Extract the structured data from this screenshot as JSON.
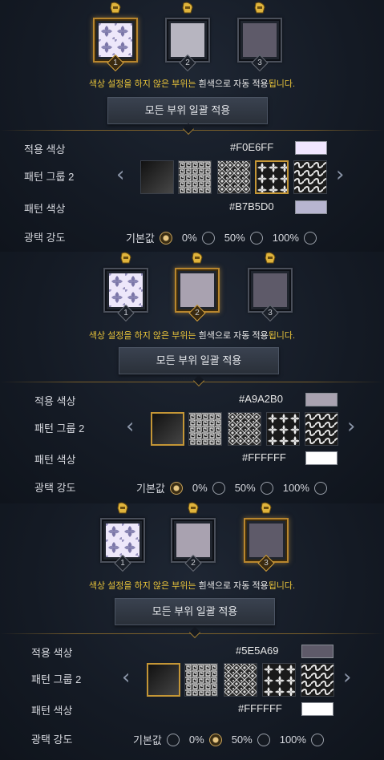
{
  "sections": [
    {
      "slots": [
        {
          "num": "1",
          "selected": true,
          "fill": "floral"
        },
        {
          "num": "2",
          "selected": false,
          "fill": "#B7B5C0"
        },
        {
          "num": "3",
          "selected": false,
          "fill": "#5E5A69"
        }
      ],
      "notice": {
        "yellow_a": "색상 설정을 하지 않은 부위는 ",
        "white": "흰색으로 자동 적용",
        "yellow_b": "됩니다."
      },
      "apply_label": "모든 부위 일괄 적용",
      "applied_color_label": "적용 색상",
      "applied_color_hex": "#F0E6FF",
      "applied_color": "#F0E6FF",
      "pattern_group_label": "패턴 그룹 2",
      "pattern_color_label": "패턴 색상",
      "pattern_color_hex": "#B7B5D0",
      "pattern_color": "#B7B5D0",
      "gloss_label": "광택 강도",
      "gloss_options": [
        "기본값",
        "0%",
        "50%",
        "100%"
      ],
      "gloss_selected": 0,
      "selected_pattern": 3
    },
    {
      "slots": [
        {
          "num": "1",
          "selected": false,
          "fill": "floral"
        },
        {
          "num": "2",
          "selected": true,
          "fill": "#A9A2B0"
        },
        {
          "num": "3",
          "selected": false,
          "fill": "#5E5A69"
        }
      ],
      "notice": {
        "yellow_a": "색상 설정을 하지 않은 부위는 ",
        "white": "흰색으로 자동 적용",
        "yellow_b": "됩니다."
      },
      "apply_label": "모든 부위 일괄 적용",
      "applied_color_label": "적용 색상",
      "applied_color_hex": "#A9A2B0",
      "applied_color": "#A9A2B0",
      "pattern_group_label": "패턴 그룹 2",
      "pattern_color_label": "패턴 색상",
      "pattern_color_hex": "#FFFFFF",
      "pattern_color": "#FFFFFF",
      "gloss_label": "광택 강도",
      "gloss_options": [
        "기본값",
        "0%",
        "50%",
        "100%"
      ],
      "gloss_selected": 0,
      "selected_pattern": 0
    },
    {
      "slots": [
        {
          "num": "1",
          "selected": false,
          "fill": "floral"
        },
        {
          "num": "2",
          "selected": false,
          "fill": "#A9A2B0"
        },
        {
          "num": "3",
          "selected": true,
          "fill": "#5E5A69"
        }
      ],
      "notice": {
        "yellow_a": "색상 설정을 하지 않은 부위는 ",
        "white": "흰색으로 자동 적용",
        "yellow_b": "됩니다."
      },
      "apply_label": "모든 부위 일괄 적용",
      "applied_color_label": "적용 색상",
      "applied_color_hex": "#5E5A69",
      "applied_color": "#5E5A69",
      "pattern_group_label": "패턴 그룹 2",
      "pattern_color_label": "패턴 색상",
      "pattern_color_hex": "#FFFFFF",
      "pattern_color": "#FFFFFF",
      "gloss_label": "광택 강도",
      "gloss_options": [
        "기본값",
        "0%",
        "50%",
        "100%"
      ],
      "gloss_selected": 1,
      "selected_pattern": 0
    }
  ],
  "arrows": {
    "prev": "‹",
    "next": "›"
  },
  "patterns": [
    "gradient-dark",
    "greek-key",
    "geometric-tile",
    "floral",
    "wave"
  ],
  "accent": "#E8C33A",
  "frame_gold": "#B8862E"
}
